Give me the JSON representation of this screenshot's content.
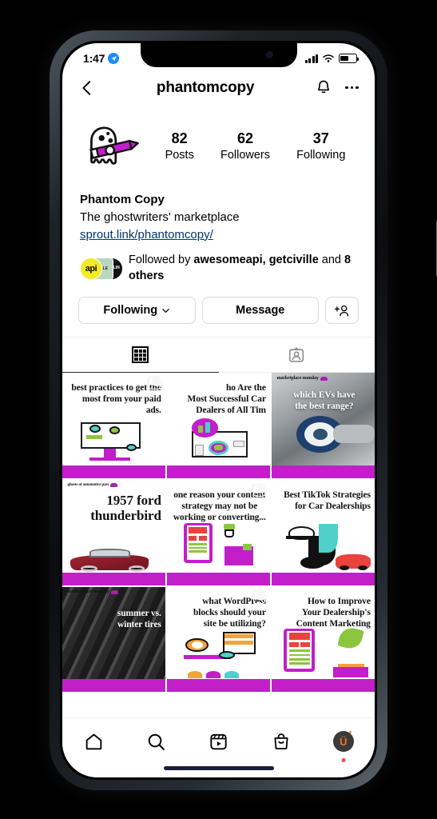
{
  "status_bar": {
    "time": "1:47",
    "location_icon": "location-arrow-icon",
    "signal_icon": "cellular-signal-icon",
    "wifi_icon": "wifi-icon",
    "battery_icon": "battery-icon",
    "battery_level_pct": 52
  },
  "header": {
    "back_icon": "back-chevron-icon",
    "title": "phantomcopy",
    "notification_icon": "bell-icon",
    "more_icon": "more-options-icon"
  },
  "profile": {
    "avatar_icon": "ghost-pencil-avatar",
    "stats": [
      {
        "number": "82",
        "label": "Posts"
      },
      {
        "number": "62",
        "label": "Followers"
      },
      {
        "number": "37",
        "label": "Following"
      }
    ],
    "display_name": "Phantom Copy",
    "bio": "The ghostwriters' marketplace",
    "link": "sprout.link/phantomcopy/",
    "followed_by": {
      "prefix": "Followed by ",
      "names": "awesomeapi, getciville",
      "middle": " and ",
      "others": "8 others",
      "avatars": [
        {
          "label": "api",
          "color": "#f2ea24"
        },
        {
          "label": "VILLE",
          "color": "#b9d6bf"
        },
        {
          "label": "GOBLIN",
          "color": "#131313"
        }
      ]
    }
  },
  "actions": {
    "following_label": "Following",
    "following_chevron": "chevron-down-icon",
    "message_label": "Message",
    "add_user_icon": "add-person-icon"
  },
  "tabs": [
    {
      "name": "grid",
      "icon": "grid-icon",
      "active": true
    },
    {
      "name": "tagged",
      "icon": "tagged-person-icon",
      "active": false
    }
  ],
  "posts": [
    {
      "id": "paid-ads",
      "text": "best practices to get the\nmost from your paid ads.",
      "align": "right",
      "badge": "",
      "carousel": true,
      "style": "illustration"
    },
    {
      "id": "successful-car-dealers",
      "text": "ho Are the\nMost Successful Car\nDealers of All Tim",
      "align": "right",
      "badge": "",
      "carousel": false,
      "style": "illustration"
    },
    {
      "id": "ev-range",
      "text": "which EVs have\nthe best range?",
      "align": "center",
      "badge": "marketplace monday",
      "carousel": false,
      "style": "photo-ev"
    },
    {
      "id": "1957-ford-thunderbird",
      "text": "1957 ford\nthunderbird",
      "align": "right",
      "badge": "ghosts of automotive past",
      "carousel": false,
      "style": "car"
    },
    {
      "id": "content-strategy",
      "text": "one reason your content\nstrategy may not be\nworking or converting...",
      "align": "center",
      "badge": "",
      "carousel": true,
      "style": "illustration"
    },
    {
      "id": "tiktok-strategies",
      "text": "Best TikTok Strategies\nfor Car Dealerships",
      "align": "right",
      "badge": "",
      "carousel": false,
      "style": "tiktok"
    },
    {
      "id": "summer-vs-winter-tires",
      "text": "summer vs.\nwinter tires",
      "align": "right",
      "badge": "marketplace monday",
      "carousel": false,
      "style": "photo-tire"
    },
    {
      "id": "wordpress-blocks",
      "text": "what WordPress\nblocks should your\nsite be utilizing?",
      "align": "right",
      "badge": "",
      "carousel": true,
      "style": "illustration"
    },
    {
      "id": "improve-content-marketing",
      "text": "How to Improve\nYour Dealership's\nContent Marketing",
      "align": "right",
      "badge": "",
      "carousel": false,
      "style": "illustration"
    }
  ],
  "bottom_nav": [
    {
      "name": "home",
      "icon": "home-icon"
    },
    {
      "name": "search",
      "icon": "search-icon"
    },
    {
      "name": "reels",
      "icon": "reels-icon"
    },
    {
      "name": "shop",
      "icon": "shop-bag-icon"
    },
    {
      "name": "profile",
      "icon": "profile-avatar",
      "label": "Ü",
      "badge_dot": true
    }
  ],
  "colors": {
    "brand_purple": "#c21fc9",
    "link_blue": "#00376b",
    "notification_red": "#ed4956"
  }
}
